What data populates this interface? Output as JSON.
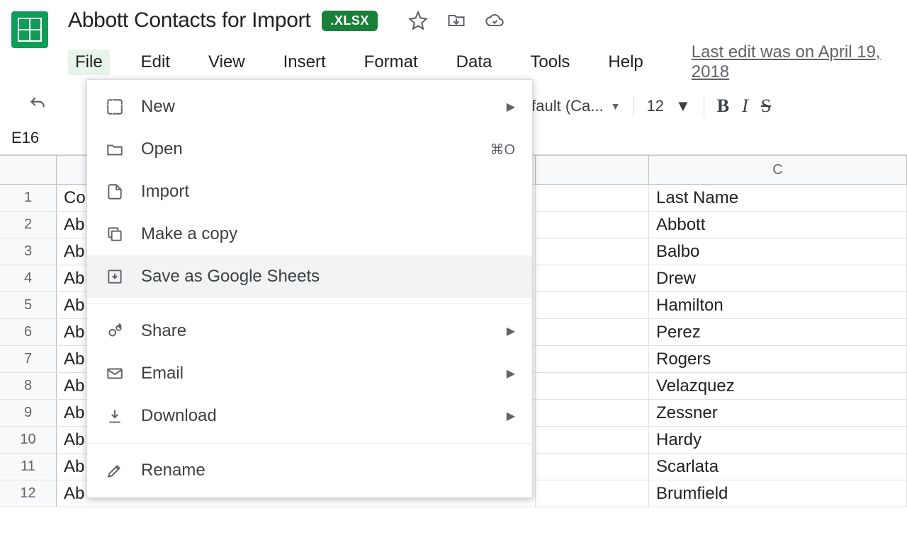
{
  "header": {
    "title": "Abbott Contacts for Import",
    "badge": ".XLSX",
    "last_edit": "Last edit was on April 19, 2018"
  },
  "menus": [
    "File",
    "Edit",
    "View",
    "Insert",
    "Format",
    "Data",
    "Tools",
    "Help"
  ],
  "file_menu": {
    "new": "New",
    "open": "Open",
    "open_shortcut": "⌘O",
    "import": "Import",
    "make_copy": "Make a copy",
    "save_as": "Save as Google Sheets",
    "share": "Share",
    "email": "Email",
    "download": "Download",
    "rename": "Rename"
  },
  "toolbar": {
    "font": "Default (Ca...",
    "size": "12"
  },
  "name_box": "E16",
  "columns": [
    "",
    "",
    "C"
  ],
  "rows": [
    {
      "n": "1",
      "a": "Co",
      "c": "Last Name"
    },
    {
      "n": "2",
      "a": "Ab",
      "c": "Abbott"
    },
    {
      "n": "3",
      "a": "Ab",
      "c": "Balbo"
    },
    {
      "n": "4",
      "a": "Ab",
      "c": "Drew"
    },
    {
      "n": "5",
      "a": "Ab",
      "c": "Hamilton"
    },
    {
      "n": "6",
      "a": "Ab",
      "c": "Perez"
    },
    {
      "n": "7",
      "a": "Ab",
      "c": "Rogers"
    },
    {
      "n": "8",
      "a": "Ab",
      "c": "Velazquez"
    },
    {
      "n": "9",
      "a": "Ab",
      "c": "Zessner"
    },
    {
      "n": "10",
      "a": "Ab",
      "c": "Hardy"
    },
    {
      "n": "11",
      "a": "Ab",
      "c": "Scarlata"
    },
    {
      "n": "12",
      "a": "Ab",
      "c": "Brumfield"
    }
  ]
}
